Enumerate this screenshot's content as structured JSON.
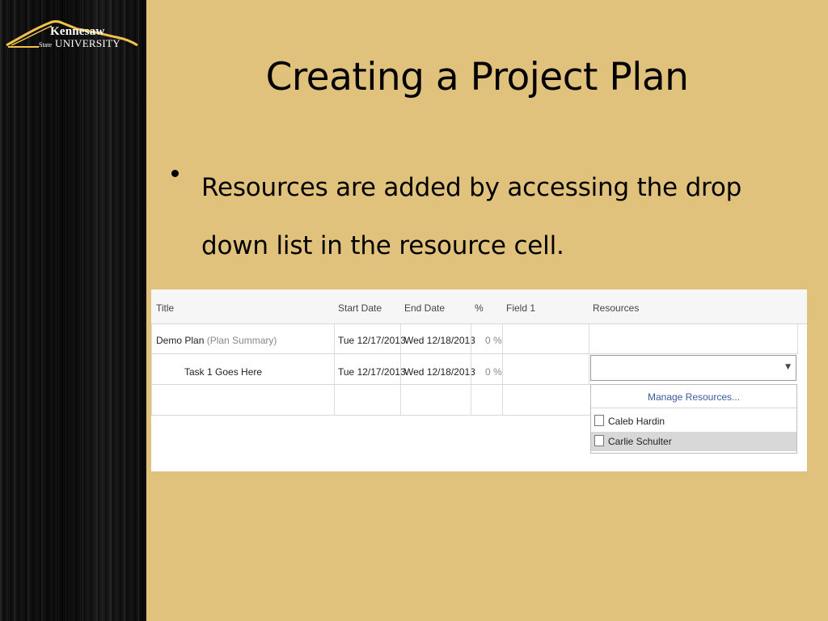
{
  "slide": {
    "title": "Creating a Project Plan",
    "bullet": "Resources are added by accessing the drop down list in the resource cell."
  },
  "logo": {
    "line1": "Kennesaw",
    "line2": "State",
    "line3": "UNIVERSITY",
    "colors": {
      "mark": "#f2c14e",
      "text": "#ffffff"
    }
  },
  "table": {
    "columns": [
      "Title",
      "Start Date",
      "End Date",
      "%",
      "Field 1",
      "Resources"
    ],
    "rows": [
      {
        "title": "Demo Plan",
        "title_note": "(Plan Summary)",
        "start": "Tue 12/17/2013",
        "end": "Wed 12/18/2013",
        "pct": "0 %"
      },
      {
        "title": "Task 1 Goes Here",
        "title_note": "",
        "start": "Tue 12/17/2013",
        "end": "Wed 12/18/2013",
        "pct": "0 %"
      }
    ]
  },
  "dropdown": {
    "value": "",
    "arrow": "▼",
    "manage_link": "Manage Resources...",
    "options": [
      {
        "label": "Caleb Hardin",
        "checked": false,
        "highlighted": false
      },
      {
        "label": "Carlie Schulter",
        "checked": false,
        "highlighted": true
      }
    ]
  },
  "colors": {
    "slide_bg": "#e0c27c",
    "sidebar_bg": "#111111",
    "link": "#3a5d9a"
  }
}
